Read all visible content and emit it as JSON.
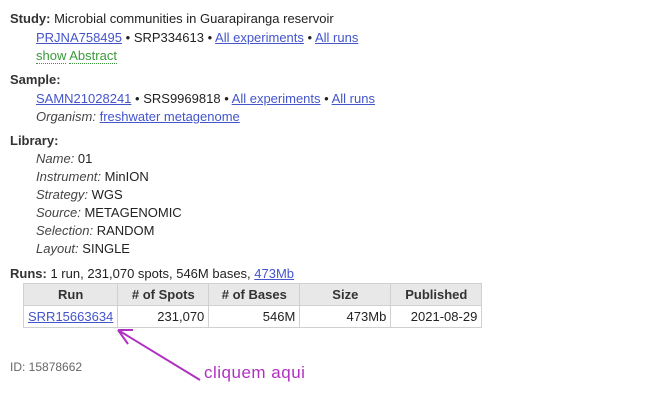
{
  "study": {
    "label": "Study:",
    "title": "Microbial communities in Guarapiranga reservoir",
    "bioproject": "PRJNA758495",
    "srp": "SRP334613",
    "all_experiments": "All experiments",
    "all_runs": "All runs",
    "show_word": "show",
    "abstract_word": "Abstract"
  },
  "sample": {
    "label": "Sample:",
    "biosample": "SAMN21028241",
    "srs": "SRS9969818",
    "all_experiments": "All experiments",
    "all_runs": "All runs",
    "organism_label": "Organism:",
    "organism": "freshwater metagenome"
  },
  "library": {
    "label": "Library:",
    "fields": [
      {
        "name": "Name:",
        "value": "01"
      },
      {
        "name": "Instrument:",
        "value": "MinION"
      },
      {
        "name": "Strategy:",
        "value": "WGS"
      },
      {
        "name": "Source:",
        "value": "METAGENOMIC"
      },
      {
        "name": "Selection:",
        "value": "RANDOM"
      },
      {
        "name": "Layout:",
        "value": "SINGLE"
      }
    ]
  },
  "runs": {
    "label": "Runs:",
    "summary": "1 run, 231,070 spots, 546M bases,",
    "size_link": "473Mb",
    "columns": [
      "Run",
      "# of Spots",
      "# of Bases",
      "Size",
      "Published"
    ],
    "rows": [
      {
        "run": "SRR15663634",
        "spots": "231,070",
        "bases": "546M",
        "size": "473Mb",
        "published": "2021-08-29"
      }
    ]
  },
  "id_text": "ID: 15878662",
  "annotation": {
    "text": "cliquem aqui",
    "color": "#b030c0"
  }
}
